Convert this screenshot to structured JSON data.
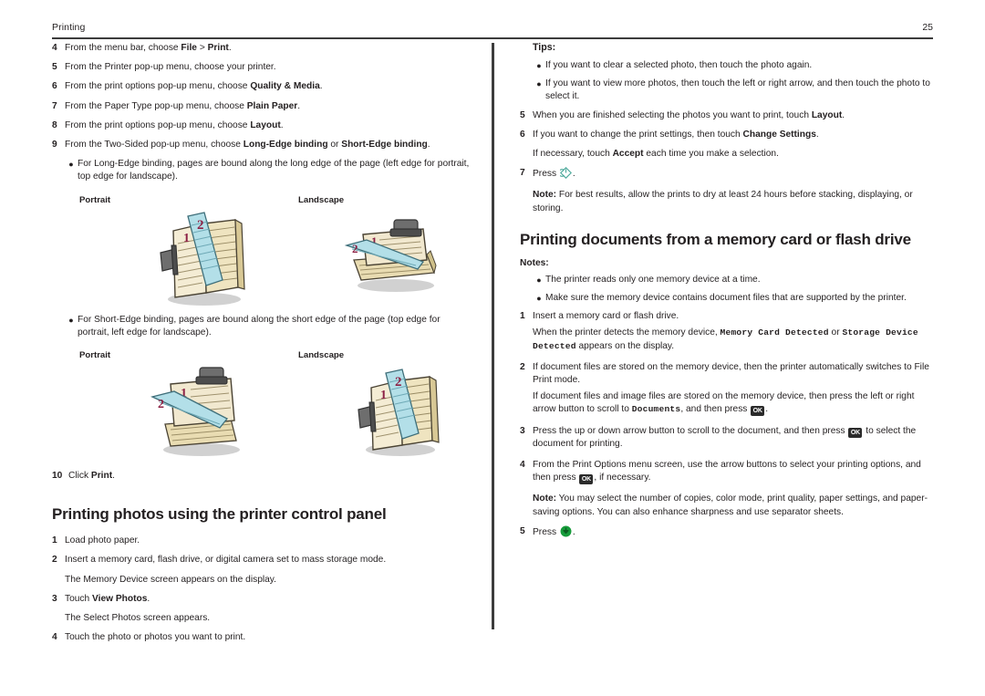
{
  "header": {
    "title": "Printing",
    "page_number": "25"
  },
  "left_column": {
    "steps_mac_print": [
      {
        "num": "4",
        "parts": [
          {
            "t": "From the menu bar, choose ",
            "bold": false
          },
          {
            "t": "File",
            "bold": true
          },
          {
            "t": " > ",
            "bold": false
          },
          {
            "t": "Print",
            "bold": true
          },
          {
            "t": ".",
            "bold": false
          }
        ]
      },
      {
        "num": "5",
        "parts": [
          {
            "t": "From the Printer pop-up menu, choose your printer.",
            "bold": false
          }
        ]
      },
      {
        "num": "6",
        "parts": [
          {
            "t": "From the print options pop-up menu, choose ",
            "bold": false
          },
          {
            "t": "Quality & Media",
            "bold": true
          },
          {
            "t": ".",
            "bold": false
          }
        ]
      },
      {
        "num": "7",
        "parts": [
          {
            "t": "From the Paper Type pop-up menu, choose ",
            "bold": false
          },
          {
            "t": "Plain Paper",
            "bold": true
          },
          {
            "t": ".",
            "bold": false
          }
        ]
      },
      {
        "num": "8",
        "parts": [
          {
            "t": "From the print options pop-up menu, choose ",
            "bold": false
          },
          {
            "t": "Layout",
            "bold": true
          },
          {
            "t": ".",
            "bold": false
          }
        ]
      },
      {
        "num": "9",
        "parts": [
          {
            "t": "From the Two-Sided pop-up menu, choose ",
            "bold": false
          },
          {
            "t": "Long-Edge binding",
            "bold": true
          },
          {
            "t": " or ",
            "bold": false
          },
          {
            "t": "Short-Edge binding",
            "bold": true
          },
          {
            "t": ".",
            "bold": false
          }
        ]
      }
    ],
    "long_edge_bullet": "For Long-Edge binding, pages are bound along the long edge of the page (left edge for portrait, top edge for landscape).",
    "short_edge_bullet": "For Short-Edge binding, pages are bound along the short edge of the page (top edge for portrait, left edge for landscape).",
    "orientation_labels": {
      "portrait": "Portrait",
      "landscape": "Landscape"
    },
    "figures": {
      "long_edge_portrait": "bound-pages-long-edge-portrait-illustration",
      "long_edge_landscape": "bound-pages-long-edge-landscape-illustration",
      "short_edge_portrait": "bound-pages-short-edge-portrait-illustration",
      "short_edge_landscape": "bound-pages-short-edge-landscape-illustration",
      "page_markers": [
        "1",
        "2"
      ]
    },
    "step_10": {
      "num": "10",
      "parts": [
        {
          "t": "Click ",
          "bold": false
        },
        {
          "t": "Print",
          "bold": true
        },
        {
          "t": ".",
          "bold": false
        }
      ]
    },
    "heading_photos": "Printing photos using the printer control panel",
    "steps_photos": [
      {
        "num": "1",
        "parts": [
          {
            "t": "Load photo paper.",
            "bold": false
          }
        ],
        "followup": null
      },
      {
        "num": "2",
        "parts": [
          {
            "t": "Insert a memory card, flash drive, or digital camera set to mass storage mode.",
            "bold": false
          }
        ],
        "followup": "The Memory Device screen appears on the display."
      },
      {
        "num": "3",
        "parts": [
          {
            "t": "Touch ",
            "bold": false
          },
          {
            "t": "View Photos",
            "bold": true
          },
          {
            "t": ".",
            "bold": false
          }
        ],
        "followup": "The Select Photos screen appears."
      },
      {
        "num": "4",
        "parts": [
          {
            "t": "Touch the photo or photos you want to print.",
            "bold": false
          }
        ],
        "followup": null
      }
    ]
  },
  "right_column": {
    "tips_label": "Tips:",
    "tips": [
      "If you want to clear a selected photo, then touch the photo again.",
      "If you want to view more photos, then touch the left or right arrow, and then touch the photo to select it."
    ],
    "steps_photos_cont": [
      {
        "num": "5",
        "parts": [
          {
            "t": "When you are finished selecting the photos you want to print, touch ",
            "bold": false
          },
          {
            "t": "Layout",
            "bold": true
          },
          {
            "t": ".",
            "bold": false
          }
        ],
        "followup": null
      },
      {
        "num": "6",
        "parts": [
          {
            "t": "If you want to change the print settings, then touch ",
            "bold": false
          },
          {
            "t": "Change Settings",
            "bold": true
          },
          {
            "t": ".",
            "bold": false
          }
        ],
        "followup_parts": [
          {
            "t": "If necessary, touch ",
            "bold": false
          },
          {
            "t": "Accept",
            "bold": true
          },
          {
            "t": " each time you make a selection.",
            "bold": false
          }
        ]
      }
    ],
    "step_7": {
      "num": "7",
      "label": "Press",
      "icon": "power-start-diamond-icon",
      "trailing": "."
    },
    "note_photos": {
      "label": "Note:",
      "text": " For best results, allow the prints to dry at least 24 hours before stacking, displaying, or storing."
    },
    "heading_documents": "Printing documents from a memory card or flash drive",
    "notes_label": "Notes:",
    "notes": [
      "The printer reads only one memory device at a time.",
      "Make sure the memory device contains document files that are supported by the printer."
    ],
    "steps_documents": [
      {
        "num": "1",
        "parts": [
          {
            "t": "Insert a memory card or flash drive.",
            "bold": false
          }
        ]
      }
    ],
    "step1_followup_parts": [
      {
        "t": "When the printer detects the memory device, ",
        "style": "normal"
      },
      {
        "t": "Memory Card Detected",
        "style": "mono"
      },
      {
        "t": " or ",
        "style": "normal"
      },
      {
        "t": "Storage Device Detected",
        "style": "mono"
      },
      {
        "t": " appears on the display.",
        "style": "normal"
      }
    ],
    "step_2": {
      "num": "2",
      "main": "If document files are stored on the memory device, then the printer automatically switches to File Print mode.",
      "followup_parts": [
        {
          "t": "If document files and image files are stored on the memory device, then press the left or right arrow button to scroll to ",
          "style": "normal"
        },
        {
          "t": "Documents",
          "style": "mono"
        },
        {
          "t": ", and then press ",
          "style": "normal"
        },
        {
          "t": "OK",
          "style": "ok-icon"
        },
        {
          "t": ".",
          "style": "normal"
        }
      ]
    },
    "step_3": {
      "num": "3",
      "parts": [
        {
          "t": "Press the up or down arrow button to scroll to the document, and then press ",
          "style": "normal"
        },
        {
          "t": "OK",
          "style": "ok-icon"
        },
        {
          "t": " to select the document for printing.",
          "style": "normal"
        }
      ]
    },
    "step_4": {
      "num": "4",
      "parts": [
        {
          "t": "From the Print Options menu screen, use the arrow buttons to select your printing options, and then press ",
          "style": "normal"
        },
        {
          "t": "OK",
          "style": "ok-icon"
        },
        {
          "t": ", if necessary.",
          "style": "normal"
        }
      ]
    },
    "note_documents": {
      "label": "Note:",
      "text": " You may select the number of copies, color mode, print quality, paper settings, and paper-saving options. You can also enhance sharpness and use separator sheets."
    },
    "step_5": {
      "num": "5",
      "label": "Press",
      "icon": "green-start-button-icon",
      "trailing": "."
    },
    "ok_button_label": "OK"
  },
  "colors": {
    "text": "#231f20",
    "rule": "#3c3c3c",
    "ok_button_bg": "#2b2b2b",
    "power_icon": "#4aa89a",
    "green_button": "#169b3a",
    "paper_cream": "#f0e6c8",
    "paper_blue": "#a9dce6",
    "clip_gray": "#6e6e6e",
    "marker_maroon": "#8c2044"
  }
}
